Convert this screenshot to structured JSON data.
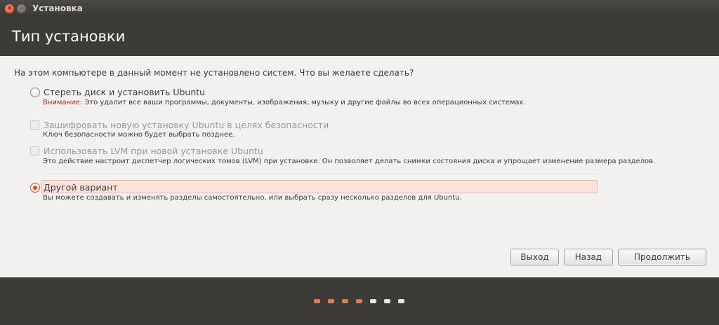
{
  "window": {
    "title": "Установка",
    "close_glyph": "×",
    "minimize_glyph": "–"
  },
  "header": {
    "title": "Тип установки"
  },
  "question": "На этом компьютере в данный момент не установлено систем. Что вы желаете сделать?",
  "options": [
    {
      "type": "radio",
      "label": "Стереть диск и установить Ubuntu",
      "warning_prefix": "Внимание:",
      "description": " Это удалит все ваши программы, документы, изображения, музыку и другие файлы во всех операционных системах.",
      "checked": false,
      "enabled": true
    },
    {
      "type": "checkbox",
      "label": "Зашифровать новую установку Ubuntu в целях безопасности",
      "description": "Ключ безопасности можно будет выбрать позднее.",
      "checked": false,
      "enabled": false
    },
    {
      "type": "checkbox",
      "label": "Использовать LVM при новой установке Ubuntu",
      "description": "Это действие настроит диспетчер логических томов (LVM) при установке. Он позволяет делать снимки состояния диска и упрощает изменение размера разделов.",
      "checked": false,
      "enabled": false
    },
    {
      "type": "radio",
      "label": "Другой вариант",
      "description": "Вы можете создавать и изменять разделы самостоятельно, или выбрать сразу несколько разделов для Ubuntu.",
      "checked": true,
      "enabled": true
    }
  ],
  "buttons": {
    "quit": "Выход",
    "back": "Назад",
    "continue": "Продолжить"
  },
  "progress": {
    "total_steps": 7,
    "completed_steps": 4,
    "active_color": "#e07a4f",
    "inactive_color": "#e8e6e3"
  }
}
